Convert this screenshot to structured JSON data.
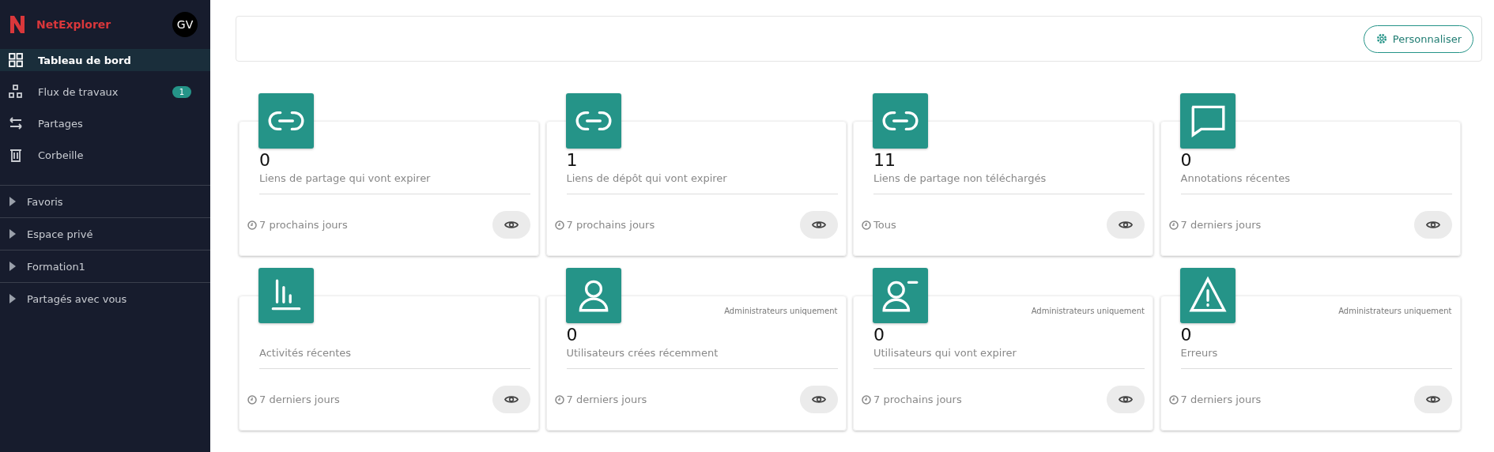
{
  "brand": {
    "name": "NetExplorer",
    "avatar": "GV"
  },
  "nav": [
    {
      "label": "Tableau de bord",
      "kind": "grid",
      "selected": true
    },
    {
      "label": "Flux de travaux",
      "kind": "flow",
      "selected": false,
      "badge": "1"
    },
    {
      "label": "Partages",
      "kind": "swap",
      "selected": false
    },
    {
      "label": "Corbeille",
      "kind": "trash",
      "selected": false
    }
  ],
  "sections": [
    {
      "label": "Favoris",
      "expanded": false
    },
    {
      "label": "Espace privé",
      "expanded": false
    },
    {
      "label": "Formation1",
      "expanded": false
    },
    {
      "label": "Partagés avec vous",
      "expanded": false
    }
  ],
  "toolbar": {
    "button": "Personnaliser"
  },
  "cards": [
    {
      "kind": "link",
      "count": "0",
      "label": "Liens de partage qui vont expirer",
      "period": "7 prochains jours"
    },
    {
      "kind": "link",
      "count": "1",
      "label": "Liens de dépôt qui vont expirer",
      "period": "7 prochains jours"
    },
    {
      "kind": "link",
      "count": "11",
      "label": "Liens de partage non téléchargés",
      "period": "Tous"
    },
    {
      "kind": "comment",
      "count": "0",
      "label": "Annotations récentes",
      "period": "7 derniers jours"
    },
    {
      "kind": "chart",
      "label": "Activités récentes",
      "period": "7 derniers jours"
    },
    {
      "kind": "user",
      "note": "Administrateurs uniquement",
      "count": "0",
      "label": "Utilisateurs crées récemment",
      "period": "7 derniers jours"
    },
    {
      "kind": "user-minus",
      "note": "Administrateurs uniquement",
      "count": "0",
      "label": "Utilisateurs qui vont expirer",
      "period": "7 prochains jours"
    },
    {
      "kind": "warning",
      "note": "Administrateurs uniquement",
      "count": "0",
      "label": "Erreurs",
      "period": "7 derniers jours"
    }
  ]
}
